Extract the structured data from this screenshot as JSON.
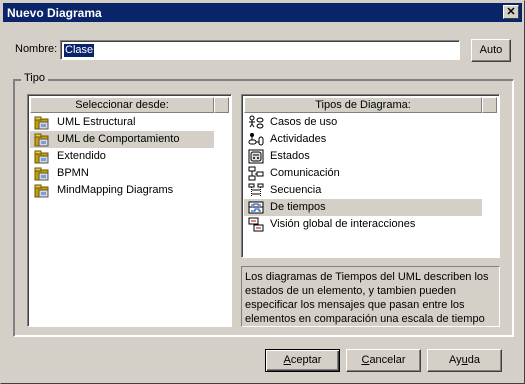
{
  "window": {
    "title": "Nuevo Diagrama",
    "close_glyph": "✕"
  },
  "name_field": {
    "label": "Nombre:",
    "value": "Clase"
  },
  "auto_button": "Auto",
  "group": {
    "title": "Tipo"
  },
  "left_list": {
    "header": "Seleccionar desde:",
    "items": [
      {
        "label": "UML Estructural",
        "icon": "folder-package-icon",
        "selected": false
      },
      {
        "label": "UML de Comportamiento",
        "icon": "folder-package-icon",
        "selected": true
      },
      {
        "label": "Extendido",
        "icon": "folder-package-icon",
        "selected": false
      },
      {
        "label": "BPMN",
        "icon": "folder-package-icon",
        "selected": false
      },
      {
        "label": "MindMapping Diagrams",
        "icon": "folder-package-icon",
        "selected": false
      }
    ]
  },
  "right_list": {
    "header": "Tipos de Diagrama:",
    "items": [
      {
        "label": "Casos de uso",
        "icon": "use-case-icon",
        "selected": false
      },
      {
        "label": "Actividades",
        "icon": "activity-icon",
        "selected": false
      },
      {
        "label": "Estados",
        "icon": "state-icon",
        "selected": false
      },
      {
        "label": "Comunicación",
        "icon": "communication-icon",
        "selected": false
      },
      {
        "label": "Secuencia",
        "icon": "sequence-icon",
        "selected": false
      },
      {
        "label": "De tiempos",
        "icon": "timing-icon",
        "selected": true
      },
      {
        "label": "Visión global de interacciones",
        "icon": "interaction-overview-icon",
        "selected": false
      }
    ]
  },
  "description": "Los diagramas de Tiempos del UML describen los estados de un elemento, y tambien pueden especificar los mensajes que pasan entre los elementos en comparación una escala de tiempo",
  "buttons": {
    "accept": {
      "first": "A",
      "rest": "ceptar"
    },
    "cancel": {
      "first": "C",
      "rest": "ancelar"
    },
    "help": {
      "first": "Ay",
      "u": "u",
      "rest": "da"
    }
  },
  "colors": {
    "titlebar": "#0a246a",
    "face": "#d4d0c8",
    "selection": "#0a246a"
  }
}
